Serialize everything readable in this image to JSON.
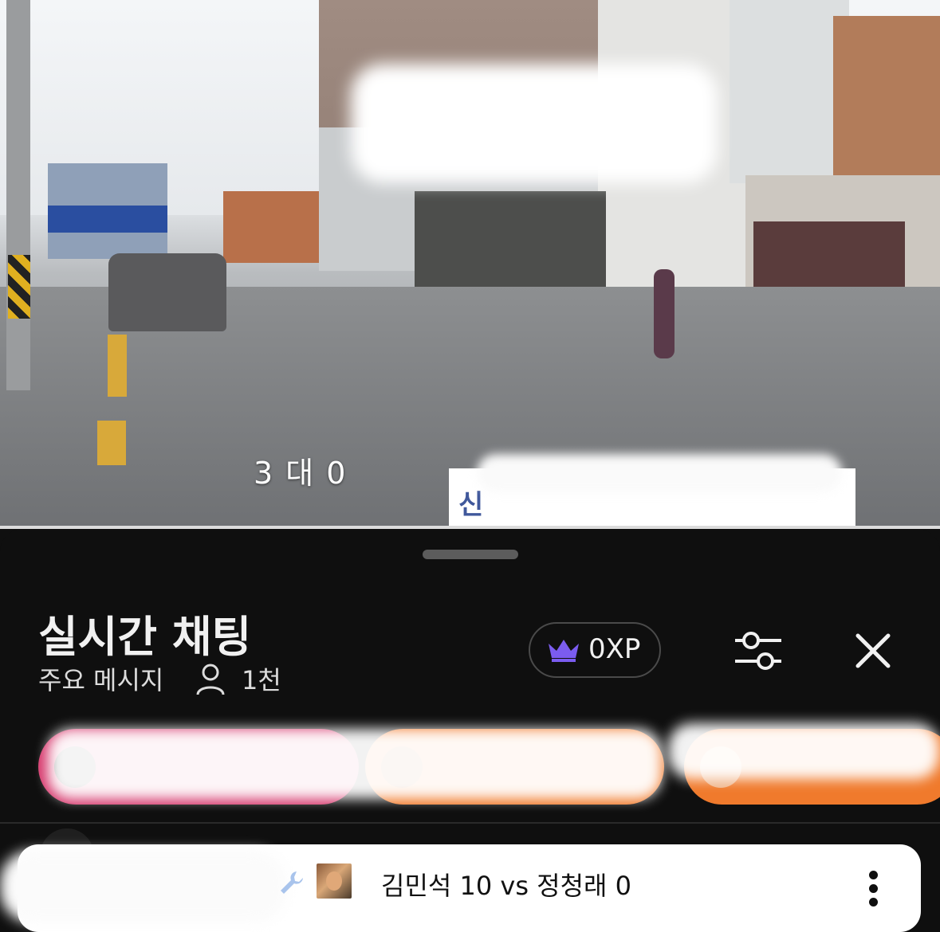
{
  "video": {
    "score_overlay": "3 대 0",
    "banner_text": "신 "
  },
  "chat": {
    "title": "실시간 채팅",
    "mode_label": "주요 메시지",
    "viewer_count": "1천",
    "xp_label": "0XP",
    "icons": {
      "xp": "crown-icon",
      "filter": "sliders-icon",
      "close": "close-icon",
      "viewers": "person-icon",
      "pinned_tool": "wrench-icon",
      "more": "more-vert-icon"
    }
  },
  "supers": {
    "chips": [
      {
        "color": "#d63a6e"
      },
      {
        "color": "#f07a2c"
      },
      {
        "color": "#f07a2c"
      }
    ]
  },
  "pinned": {
    "message": "김민석 10 vs 정청래 0"
  },
  "colors": {
    "background": "#0f0f0f",
    "xp_crown": "#7b5cf0",
    "text": "#f1f1f1"
  }
}
